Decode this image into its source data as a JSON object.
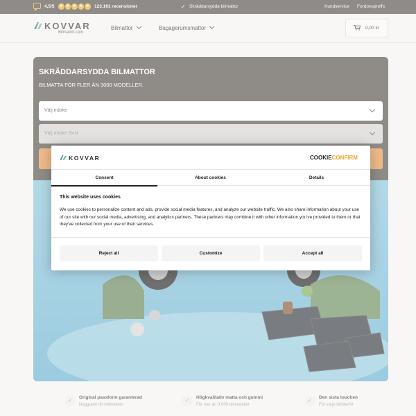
{
  "topbar": {
    "rating": "4,5/5",
    "reviews": "123.191 recensioner",
    "usp": "Skräddarsydda bilmattor",
    "links": [
      "Kundservice",
      "Fordonsproffs"
    ]
  },
  "header": {
    "logo": "KOVVAR",
    "logo_sub": "Bilmattor.com",
    "nav": [
      "Bilmattor",
      "Bagagerumsmattor"
    ],
    "cart_amount": "0,00 kr"
  },
  "hero": {
    "title": "SKRÄDDARSYDDA BILMATTOR",
    "subtitle": "BILMATTA FÖR FLER ÄN 3000 MODELLER.",
    "select_brand": "Välj märke",
    "select_model": "Välj märke först"
  },
  "cookie": {
    "logo": "KOVVAR",
    "brand_a": "C",
    "brand_b": "OOKIE",
    "brand_c": "CONFIRM",
    "tabs": [
      "Consent",
      "About cookies",
      "Details"
    ],
    "heading": "This website uses cookies",
    "body": "We use cookies to personalize content and ads, provide social media features, and analyze our website traffic. We also share information about your use of our site with our social media, advertising, and analytics partners. These partners may combine it with other information you've provided to them or that they've collected from your use of their services.",
    "buttons": [
      "Reject all",
      "Customize",
      "Accept all"
    ]
  },
  "usps": [
    {
      "title": "Original passform garanterad",
      "sub": "Noggrann till millimetern"
    },
    {
      "title": "Högkvalitativ matta och gummi",
      "sub": "För mer än 3 000 bilmodeller"
    },
    {
      "title": "Den sista touchen",
      "sub": "För varje bilinteriör"
    }
  ],
  "colors": {
    "topbar": "#5a544f",
    "accent": "#e69a52",
    "star": "#e2b23b",
    "cookie_orange": "#f0a531"
  }
}
